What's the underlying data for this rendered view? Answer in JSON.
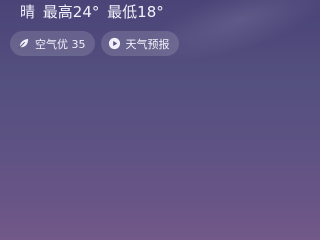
{
  "weather": {
    "condition": "晴",
    "high": "最高24°",
    "low": "最低18°"
  },
  "chips": {
    "air_quality": {
      "label": "空气优 35",
      "icon": "leaf-icon"
    },
    "forecast": {
      "label": "天气预报",
      "icon": "play-icon"
    }
  }
}
